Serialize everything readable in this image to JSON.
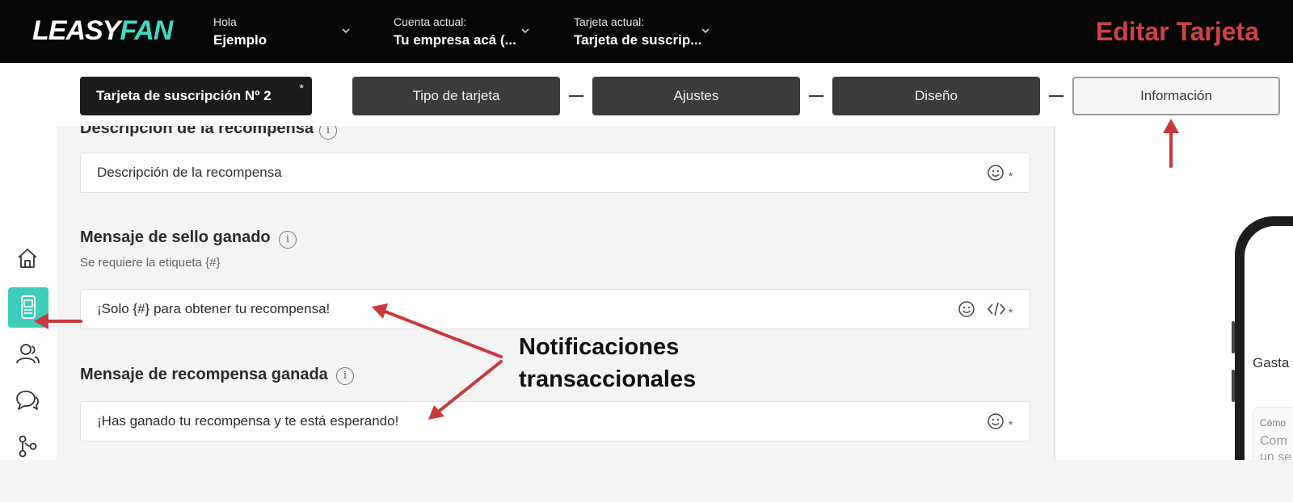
{
  "header": {
    "logo_part1": "LEASY",
    "logo_part2": "FAN",
    "greeting_label": "Hola",
    "greeting_value": "Ejemplo",
    "account_label": "Cuenta actual:",
    "account_value": "Tu empresa acá (...",
    "card_label": "Tarjeta actual:",
    "card_value": "Tarjeta de suscrip...",
    "page_title": "Editar Tarjeta"
  },
  "stepbar": {
    "card_name": "Tarjeta de suscripción Nº 2",
    "card_name_marker": "*",
    "steps": [
      {
        "label": "Tipo de tarjeta",
        "active": false
      },
      {
        "label": "Ajustes",
        "active": false
      },
      {
        "label": "Diseño",
        "active": false
      },
      {
        "label": "Información",
        "active": true
      }
    ]
  },
  "sidebar": {
    "items": [
      {
        "icon": "home-icon",
        "active": false
      },
      {
        "icon": "card-device-icon",
        "active": true
      },
      {
        "icon": "users-icon",
        "active": false
      },
      {
        "icon": "chat-icon",
        "active": false
      },
      {
        "icon": "flow-icon",
        "active": false
      }
    ]
  },
  "form": {
    "reward_description": {
      "label": "Descripción de la recompensa",
      "value": "Descripción de la recompensa",
      "required_marker": "*"
    },
    "stamp_message": {
      "label": "Mensaje de sello ganado",
      "hint": "Se requiere la etiqueta {#}",
      "value": "¡Solo {#} para obtener tu recompensa!",
      "required_marker": "*"
    },
    "reward_message": {
      "label": "Mensaje de recompensa ganada",
      "value": "¡Has ganado tu recompensa y te está esperando!",
      "required_marker": "*"
    },
    "info_glyph": "i"
  },
  "preview": {
    "text_gasta": "Gasta",
    "card_line1": "Cómo",
    "card_line2": "Com",
    "card_line3": "un se"
  },
  "annotation": {
    "line1": "Notificaciones",
    "line2": "transaccionales"
  },
  "colors": {
    "accent_teal": "#3ecdb9",
    "annotation_red": "#c9383c",
    "title_red": "#d24145",
    "topbar_bg": "#060606",
    "step_dark": "#3b3b3b"
  }
}
